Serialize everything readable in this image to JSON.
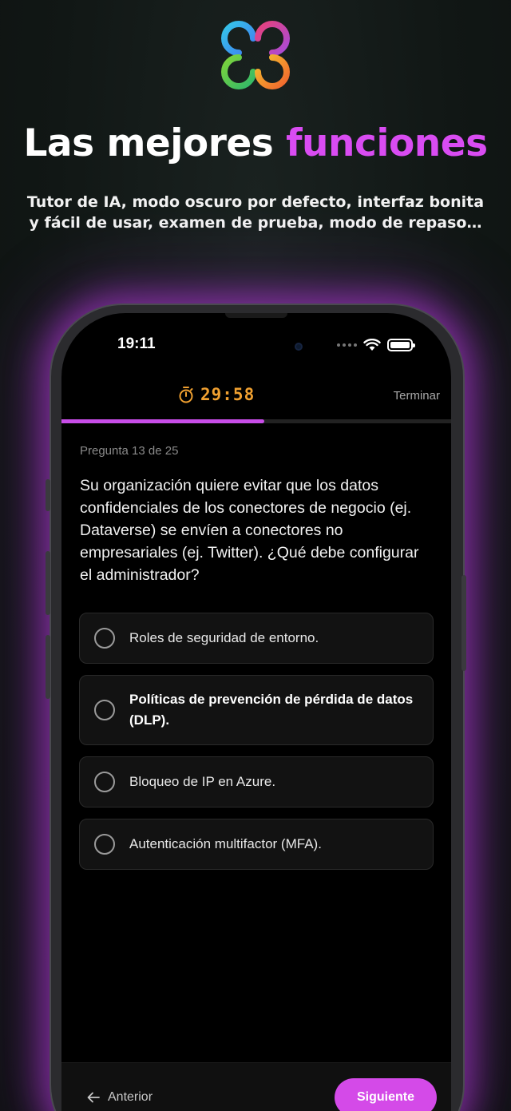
{
  "promo": {
    "headline_main": "Las mejores",
    "headline_accent": "funciones",
    "subhead": "Tutor de IA, modo oscuro por defecto, interfaz bonita y fácil de usar, examen de prueba, modo de repaso…",
    "accent_color": "#d94cf2"
  },
  "status_bar": {
    "time": "19:11",
    "icons": [
      "signal-dots-icon",
      "wifi-icon",
      "battery-icon"
    ]
  },
  "quiz": {
    "timer": "29:58",
    "timer_icon": "stopwatch-icon",
    "timer_color": "#f0a030",
    "finish_label": "Terminar",
    "progress": 0.52,
    "progress_color": "#c84de8",
    "question_counter": "Pregunta 13 de 25",
    "question": "Su organización quiere evitar que los datos confidenciales de los conectores de negocio (ej. Dataverse) se envíen a conectores no empresariales (ej. Twitter). ¿Qué debe configurar el administrador?",
    "options": [
      {
        "label": "Roles de seguridad de entorno.",
        "selected": false
      },
      {
        "label": "Políticas de prevención de pérdida de datos (DLP).",
        "selected": true
      },
      {
        "label": "Bloqueo de IP en Azure.",
        "selected": false
      },
      {
        "label": "Autenticación multifactor (MFA).",
        "selected": false
      }
    ]
  },
  "nav": {
    "prev_label": "Anterior",
    "prev_icon": "arrow-left-icon",
    "next_label": "Siguiente",
    "next_color": "#d44ae8"
  }
}
